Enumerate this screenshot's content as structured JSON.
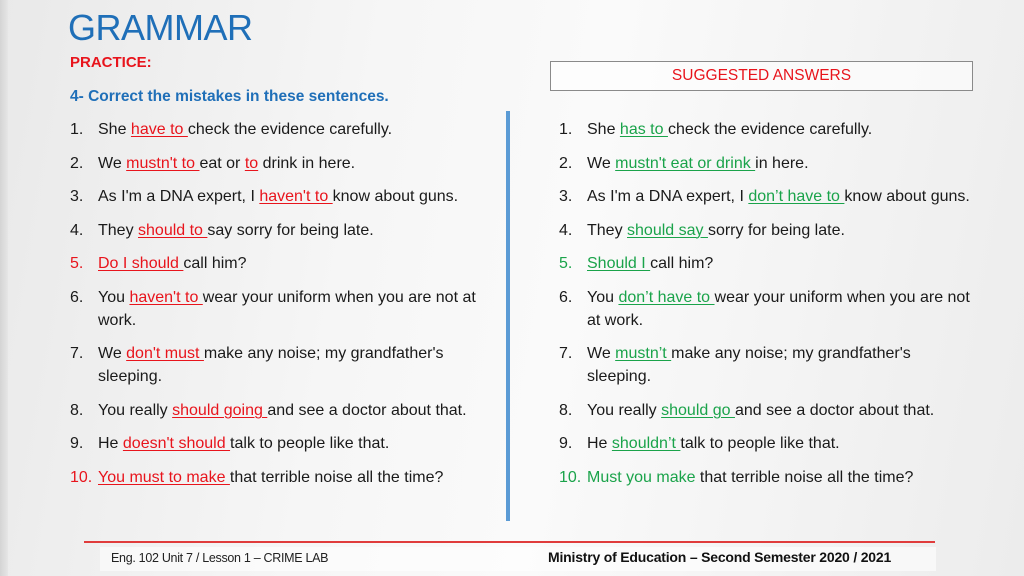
{
  "header": {
    "title": "GRAMMAR",
    "subtitle": "PRACTICE:",
    "instruction": "4- Correct the mistakes in these sentences."
  },
  "answers_header": "SUGGESTED ANSWERS",
  "colors": {
    "title_blue": "#1f6fb8",
    "mistake_red": "#e8141c",
    "answer_green": "#1aa34a",
    "divider_blue": "#5b9bd5"
  },
  "questions": [
    {
      "num": "1.",
      "before": "She ",
      "highlight": "have to ",
      "after": "check the evidence carefully."
    },
    {
      "num": "2.",
      "before": "We ",
      "highlight": "mustn't to ",
      "middle": "eat or ",
      "highlight2": "to",
      "after": " drink in here."
    },
    {
      "num": "3.",
      "before": "As I'm a DNA expert, I ",
      "highlight": "haven't to ",
      "after": "know about guns."
    },
    {
      "num": "4.",
      "before": "They ",
      "highlight": "should to ",
      "after": "say sorry for being late."
    },
    {
      "num": "5.",
      "before": "",
      "highlight": "Do I should ",
      "after": "call him?"
    },
    {
      "num": "6.",
      "before": "You ",
      "highlight": "haven't to ",
      "after": "wear your uniform when you are not at work."
    },
    {
      "num": "7.",
      "before": "We ",
      "highlight": "don't must ",
      "after": "make any noise; my grandfather's sleeping."
    },
    {
      "num": "8.",
      "before": "You really ",
      "highlight": "should going ",
      "after": "and see a doctor about that."
    },
    {
      "num": "9.",
      "before": "He ",
      "highlight": "doesn't should ",
      "after": "talk to people like that."
    },
    {
      "num": "10.",
      "before": "",
      "highlight": "You must to make ",
      "after": "that terrible noise all the time?"
    }
  ],
  "answers": [
    {
      "num": "1.",
      "before": "She ",
      "highlight": "has to ",
      "after": "check the evidence carefully."
    },
    {
      "num": "2.",
      "before": "We ",
      "highlight": "mustn't eat or drink ",
      "after": "in here."
    },
    {
      "num": "3.",
      "before": "As I'm a DNA expert, I ",
      "highlight": "don’t have to ",
      "after": "know about guns."
    },
    {
      "num": "4.",
      "before": "They ",
      "highlight": "should say ",
      "after": "sorry for being late."
    },
    {
      "num": "5.",
      "before": "",
      "highlight": "Should I ",
      "after": "call him?"
    },
    {
      "num": "6.",
      "before": "You ",
      "highlight": "don’t have to ",
      "after": "wear your uniform when you are not at work."
    },
    {
      "num": "7.",
      "before": "We ",
      "highlight": "mustn’t ",
      "after": "make any noise; my grandfather's sleeping."
    },
    {
      "num": "8.",
      "before": "You really ",
      "highlight": "should go ",
      "after": "and see a doctor about that."
    },
    {
      "num": "9.",
      "before": "He ",
      "highlight": "shouldn’t ",
      "after": "talk to people like that."
    },
    {
      "num": "10.",
      "before": "",
      "highlight": "Must you make",
      "after": " that terrible noise all the time?"
    }
  ],
  "footer": {
    "left": "Eng. 102 Unit 7 / Lesson 1 – CRIME LAB",
    "right": "Ministry of Education – Second Semester 2020 / 2021"
  }
}
